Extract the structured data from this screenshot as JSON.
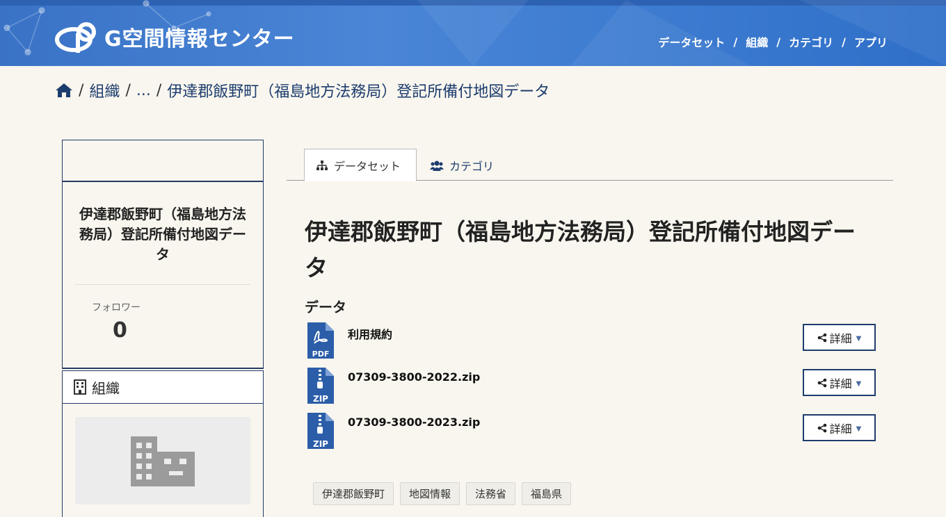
{
  "header": {
    "logo_text": "G空間情報センター",
    "nav": [
      "データセット",
      "組織",
      "カテゴリ",
      "アプリ"
    ],
    "nav_separator": "/"
  },
  "breadcrumb": {
    "home_icon": "home-icon",
    "items": [
      "組織",
      "...",
      "伊達郡飯野町（福島地方法務局）登記所備付地図データ"
    ],
    "separator": "/"
  },
  "sidebar": {
    "org_name": "伊達郡飯野町（福島地方法務局）登記所備付地図データ",
    "followers_label": "フォロワー",
    "followers_count": "0",
    "org_section_label": "組織",
    "org_section_icon": "building-icon",
    "org_image_icon": "building-placeholder-icon"
  },
  "tabs": [
    {
      "label": "データセット",
      "icon": "sitemap-icon",
      "active": true
    },
    {
      "label": "カテゴリ",
      "icon": "users-icon",
      "active": false
    }
  ],
  "dataset": {
    "title": "伊達郡飯野町（福島地方法務局）登記所備付地図データ",
    "resources_heading": "データ",
    "resources": [
      {
        "name": "利用規約",
        "format": "PDF",
        "icon": "pdf-file-icon",
        "action": "詳細"
      },
      {
        "name": "07309-3800-2022.zip",
        "format": "ZIP",
        "icon": "zip-file-icon",
        "action": "詳細"
      },
      {
        "name": "07309-3800-2023.zip",
        "format": "ZIP",
        "icon": "zip-file-icon",
        "action": "詳細"
      }
    ],
    "tags": [
      "伊達郡飯野町",
      "地図情報",
      "法務省",
      "福島県"
    ]
  },
  "colors": {
    "header_blue": "#3a73c6",
    "navy": "#1d3c6e",
    "background": "#f8f6ee",
    "file_icon_blue": "#2b5da8"
  }
}
